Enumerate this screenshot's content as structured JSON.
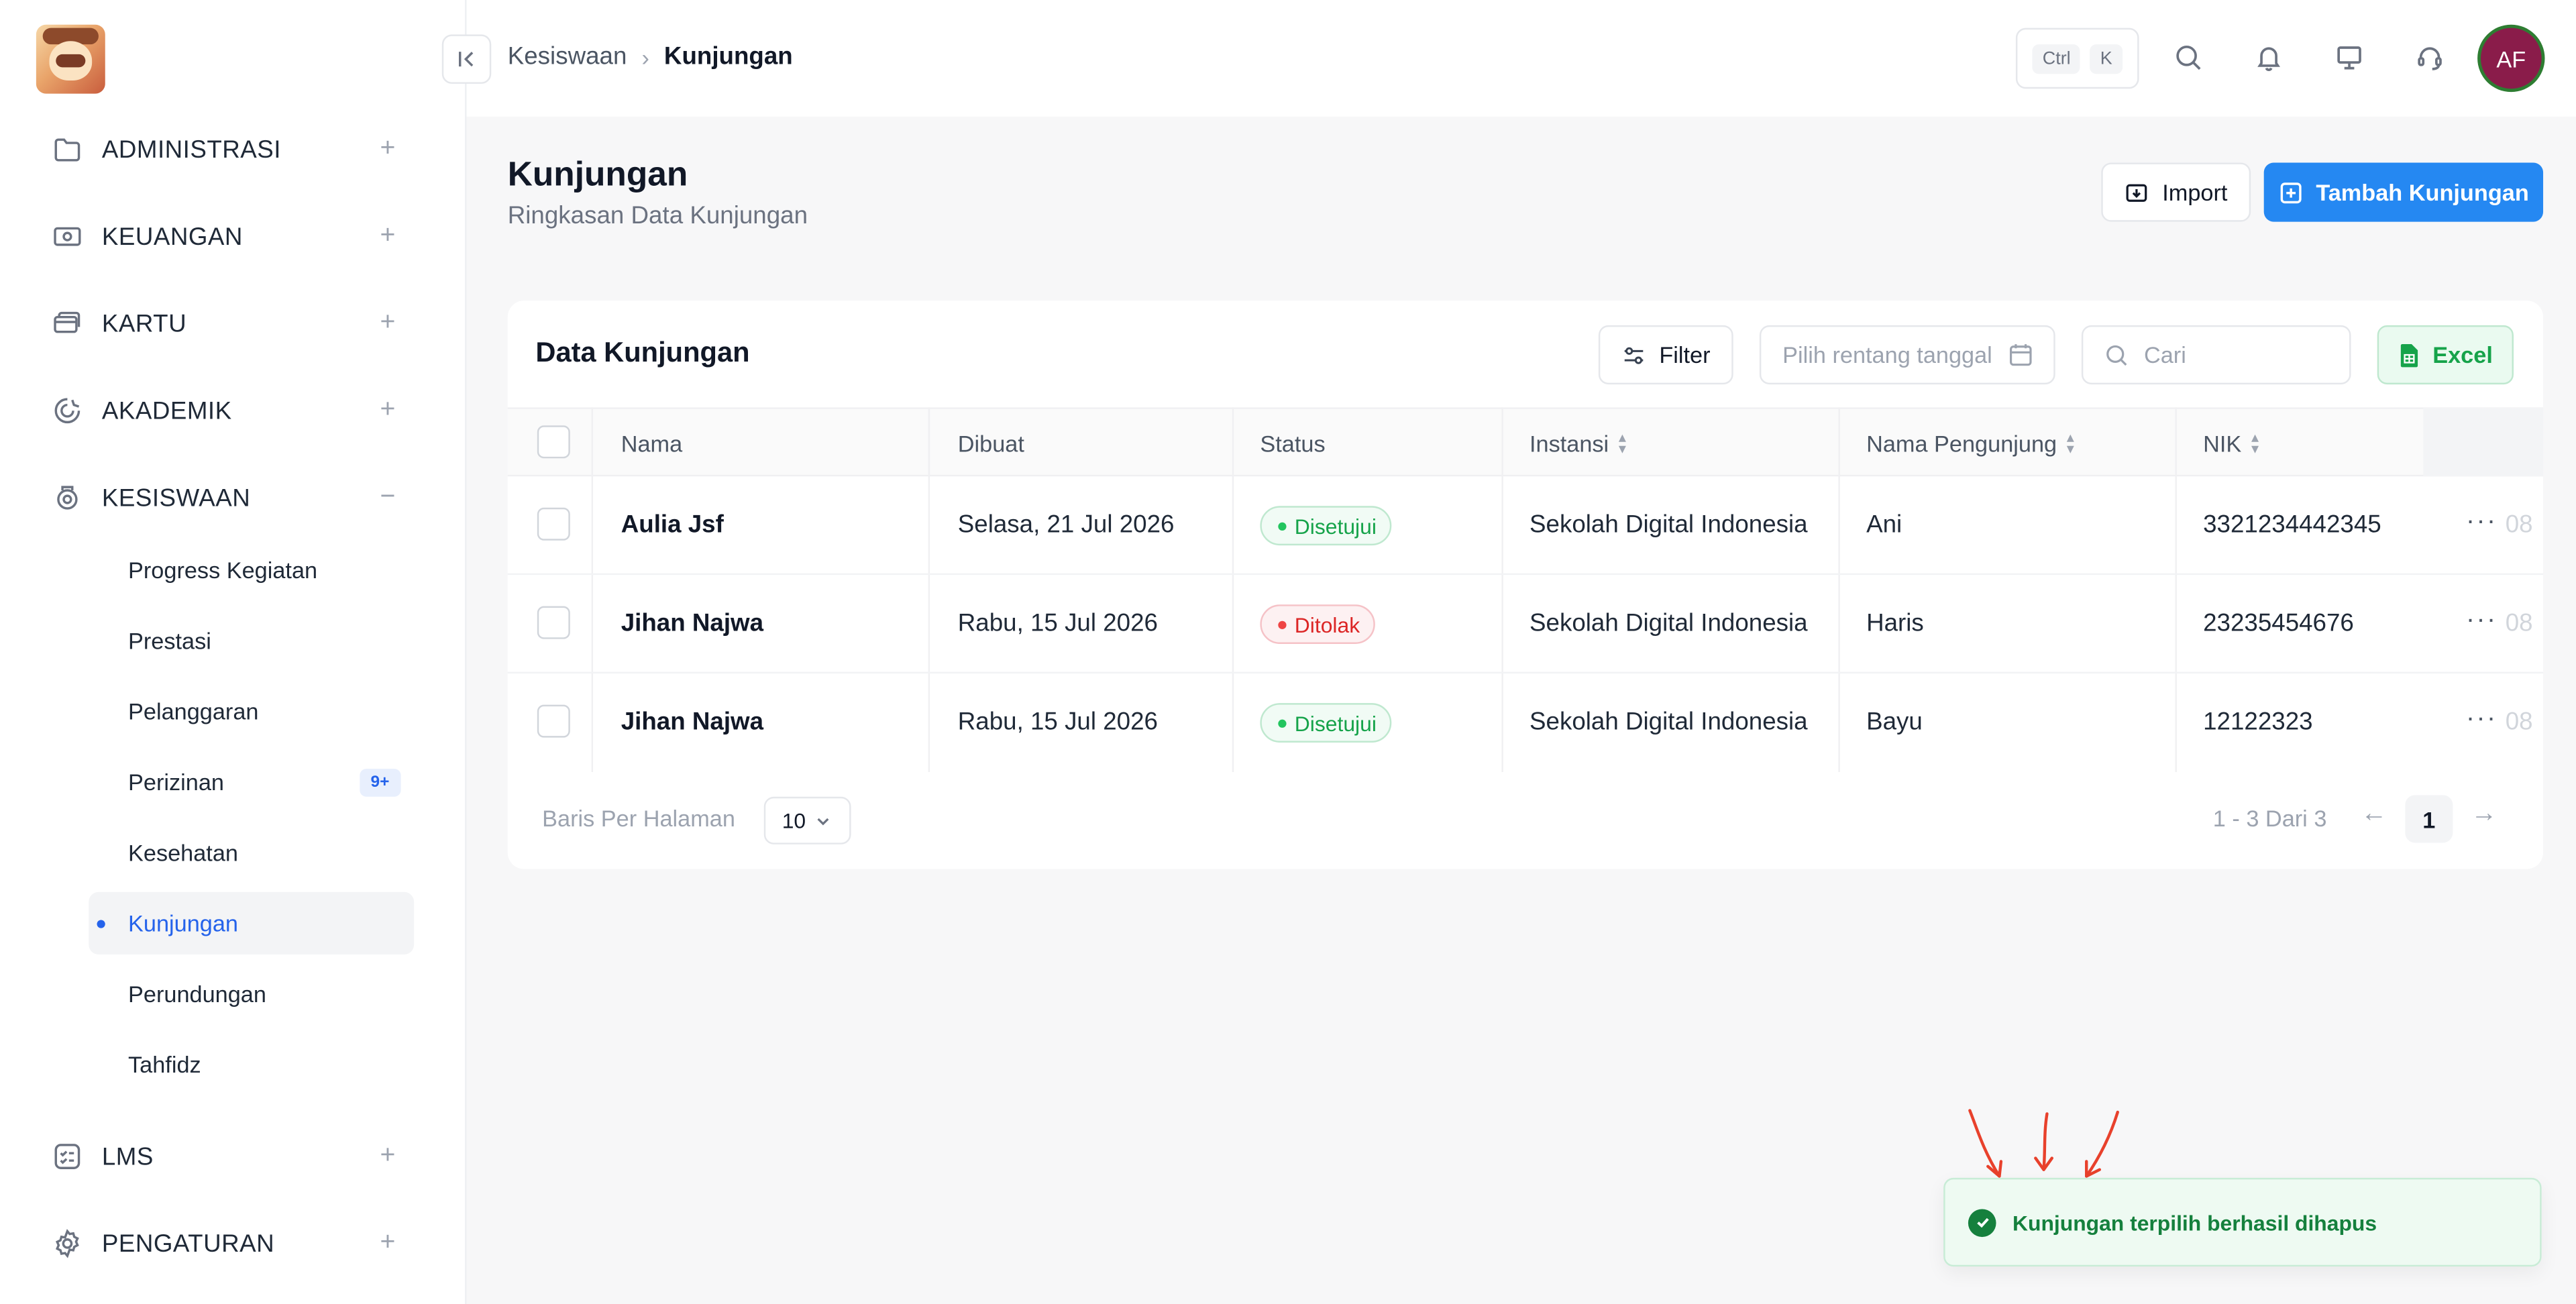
{
  "sidebar": {
    "items": [
      {
        "label": "ADMINISTRASI",
        "icon": "folder-icon",
        "toggle": "+"
      },
      {
        "label": "KEUANGAN",
        "icon": "cash-icon",
        "toggle": "+"
      },
      {
        "label": "KARTU",
        "icon": "card-icon",
        "toggle": "+"
      },
      {
        "label": "AKADEMIK",
        "icon": "book-icon",
        "toggle": "+"
      },
      {
        "label": "KESISWAAN",
        "icon": "student-icon",
        "toggle": "−"
      },
      {
        "label": "LMS",
        "icon": "checklist-icon",
        "toggle": "+"
      },
      {
        "label": "PENGATURAN",
        "icon": "gear-icon",
        "toggle": "+"
      }
    ],
    "sub_items": [
      {
        "label": "Progress Kegiatan"
      },
      {
        "label": "Prestasi"
      },
      {
        "label": "Pelanggaran"
      },
      {
        "label": "Perizinan",
        "badge": "9+"
      },
      {
        "label": "Kesehatan"
      },
      {
        "label": "Kunjungan",
        "active": true
      },
      {
        "label": "Perundungan"
      },
      {
        "label": "Tahfidz"
      }
    ]
  },
  "header": {
    "breadcrumb": [
      "Kesiswaan",
      "Kunjungan"
    ],
    "shortcut": [
      "Ctrl",
      "K"
    ],
    "avatar_initials": "AF"
  },
  "page": {
    "title": "Kunjungan",
    "subtitle": "Ringkasan Data Kunjungan",
    "import_label": "Import",
    "add_label": "Tambah Kunjungan"
  },
  "card": {
    "title": "Data Kunjungan",
    "filter_label": "Filter",
    "date_placeholder": "Pilih rentang tanggal",
    "search_placeholder": "Cari",
    "excel_label": "Excel"
  },
  "table": {
    "columns": [
      "Nama",
      "Dibuat",
      "Status",
      "Instansi",
      "Nama Pengunjung",
      "NIK"
    ],
    "rows": [
      {
        "nama": "Aulia Jsf",
        "dibuat": "Selasa, 21 Jul 2026",
        "status": "Disetujui",
        "instansi": "Sekolah Digital Indonesia",
        "pengunjung": "Ani",
        "nik": "3321234442345",
        "extra": "08"
      },
      {
        "nama": "Jihan Najwa",
        "dibuat": "Rabu, 15 Jul 2026",
        "status": "Ditolak",
        "instansi": "Sekolah Digital Indonesia",
        "pengunjung": "Haris",
        "nik": "23235454676",
        "extra": "08"
      },
      {
        "nama": "Jihan Najwa",
        "dibuat": "Rabu, 15 Jul 2026",
        "status": "Disetujui",
        "instansi": "Sekolah Digital Indonesia",
        "pengunjung": "Bayu",
        "nik": "12122323",
        "extra": "08"
      }
    ]
  },
  "pagination": {
    "per_page_label": "Baris Per Halaman",
    "per_page_value": "10",
    "range": "1 - 3 Dari 3",
    "current_page": "1"
  },
  "toast": {
    "message": "Kunjungan terpilih berhasil dihapus"
  },
  "colors": {
    "primary": "#2588f2",
    "success": "#16a34a",
    "danger": "#dc2626",
    "avatar": "#8a1c4a",
    "annotation": "#e8412c"
  }
}
